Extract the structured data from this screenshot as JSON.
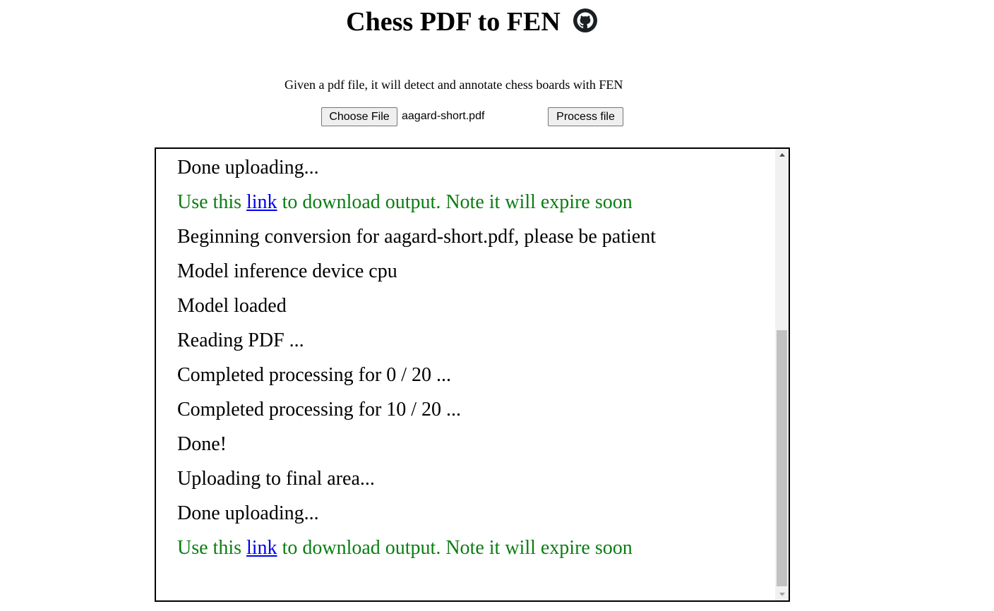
{
  "header": {
    "title": "Chess PDF to FEN",
    "github_icon": "github-icon"
  },
  "description": "Given a pdf file, it will detect and annotate chess boards with FEN",
  "upload": {
    "choose_label": "Choose File",
    "file_name": "aagard-short.pdf",
    "process_label": "Process file"
  },
  "log": {
    "link_color": "#0000ee",
    "success_color": "#0a7d12",
    "lines": [
      {
        "text": "Uploading to final area..."
      },
      {
        "text": "Done uploading..."
      },
      {
        "before": "Use this ",
        "link": "link",
        "after": " to download output. Note it will expire soon"
      },
      {
        "text": "Beginning conversion for aagard-short.pdf, please be patient"
      },
      {
        "text": "Model inference device cpu"
      },
      {
        "text": "Model loaded"
      },
      {
        "text": "Reading PDF ..."
      },
      {
        "text": "Completed processing for 0 / 20 ..."
      },
      {
        "text": "Completed processing for 10 / 20 ..."
      },
      {
        "text": "Done!"
      },
      {
        "text": "Uploading to final area..."
      },
      {
        "text": "Done uploading..."
      },
      {
        "before": "Use this ",
        "link": "link",
        "after": " to download output. Note it will expire soon"
      }
    ]
  }
}
